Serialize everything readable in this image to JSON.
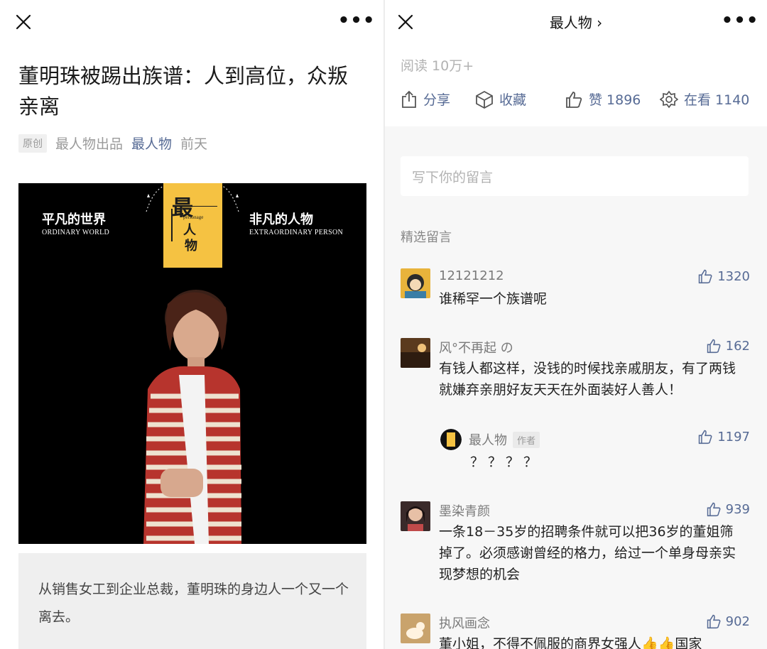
{
  "left": {
    "nav": {
      "close_icon": "close-icon",
      "more_icon": "more-icon",
      "more_label": "•••"
    },
    "article": {
      "title": "董明珠被踢出族谱：人到高位，众叛亲离",
      "badge": "原创",
      "producer": "最人物出品",
      "account": "最人物",
      "time": "前天"
    },
    "poster": {
      "left_title": "平凡的世界",
      "left_sub": "ORDINARY WORLD",
      "right_title": "非凡的人物",
      "right_sub": "EXTRAORDINARY PERSON",
      "logo_char1": "最",
      "logo_char2": "人",
      "logo_char3": "物",
      "logo_sub": "personage",
      "colors": {
        "logo": "#f5c242",
        "background": "#000000"
      }
    },
    "summary": "从销售女工到企业总裁，董明珠的身边人一个又一个离去。"
  },
  "right": {
    "nav": {
      "title": "最人物 ›",
      "close_icon": "close-icon",
      "more_label": "•••"
    },
    "read": "阅读 10万+",
    "actions": {
      "share": "分享",
      "favorite": "收藏",
      "like": "赞 1896",
      "watching": "在看 1140"
    },
    "comment_placeholder": "写下你的留言",
    "featured_title": "精选留言",
    "comments": [
      {
        "name": "12121212",
        "likes": "1320",
        "text": "谁稀罕一个族谱呢"
      },
      {
        "name": "风°不再起 の",
        "likes": "162",
        "text": "有钱人都这样，没钱的时候找亲戚朋友，有了两钱就嫌弃亲朋好友天天在外面装好人善人！",
        "reply": {
          "name": "最人物",
          "badge": "作者",
          "likes": "1197",
          "text": "？？？？"
        }
      },
      {
        "name": "墨染青颜",
        "likes": "939",
        "text": "一条18－35岁的招聘条件就可以把36岁的董姐筛掉了。必须感谢曾经的格力，给过一个单身母亲实现梦想的机会"
      },
      {
        "name": "执风画念",
        "likes": "902",
        "text": "董小姐，不得不佩服的商界女强人👍👍国家"
      }
    ],
    "colors": {
      "link": "#576b95",
      "panel_bg": "#f7f7f7"
    }
  }
}
